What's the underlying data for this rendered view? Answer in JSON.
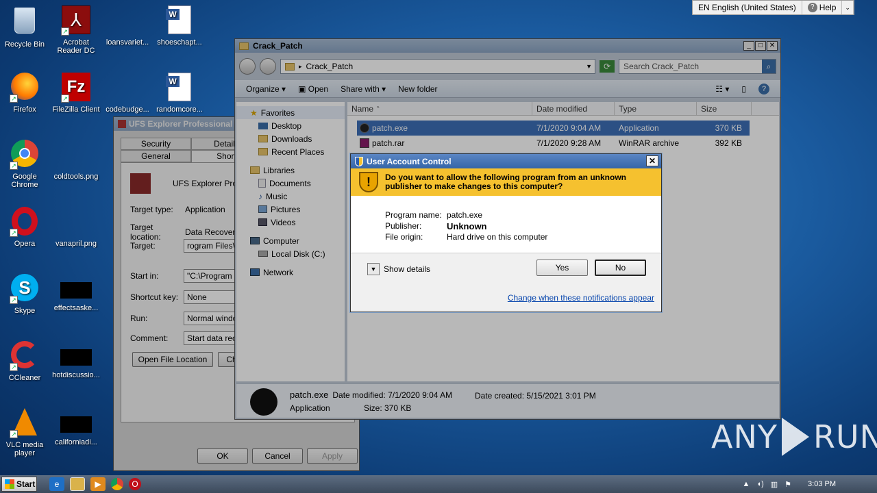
{
  "language_bar": {
    "language": "EN English (United States)",
    "help": "Help"
  },
  "desktop_icons": [
    {
      "label": "Recycle Bin"
    },
    {
      "label": "Acrobat Reader DC"
    },
    {
      "label": "loansvariet..."
    },
    {
      "label": "shoeschapt..."
    },
    {
      "label": "Firefox"
    },
    {
      "label": "FileZilla Client"
    },
    {
      "label": "codebudge..."
    },
    {
      "label": "randomcore..."
    },
    {
      "label": "Google Chrome"
    },
    {
      "label": "coldtools.png"
    },
    {
      "label": "Opera"
    },
    {
      "label": "vanapril.png"
    },
    {
      "label": "Skype"
    },
    {
      "label": "effectsaske..."
    },
    {
      "label": "CCleaner"
    },
    {
      "label": "hotdiscussio..."
    },
    {
      "label": "VLC media player"
    },
    {
      "label": "californiadi..."
    }
  ],
  "explorer": {
    "title": "Crack_Patch",
    "address": "Crack_Patch",
    "search_placeholder": "Search Crack_Patch",
    "toolbar": {
      "organize": "Organize",
      "open": "Open",
      "share_with": "Share with",
      "new_folder": "New folder"
    },
    "nav": {
      "favorites": "Favorites",
      "desktop": "Desktop",
      "downloads": "Downloads",
      "recent": "Recent Places",
      "libraries": "Libraries",
      "documents": "Documents",
      "music": "Music",
      "pictures": "Pictures",
      "videos": "Videos",
      "computer": "Computer",
      "local_disk": "Local Disk (C:)",
      "network": "Network"
    },
    "columns": {
      "name": "Name",
      "date": "Date modified",
      "type": "Type",
      "size": "Size"
    },
    "files": [
      {
        "name": "patch.exe",
        "date": "7/1/2020 9:04 AM",
        "type": "Application",
        "size": "370 KB"
      },
      {
        "name": "patch.rar",
        "date": "7/1/2020 9:28 AM",
        "type": "WinRAR archive",
        "size": "392 KB"
      }
    ],
    "details": {
      "name": "patch.exe",
      "date_modified": "Date modified: 7/1/2020 9:04 AM",
      "date_created": "Date created: 5/15/2021 3:01 PM",
      "type": "Application",
      "size": "Size: 370 KB"
    }
  },
  "ufs": {
    "title": "UFS Explorer Professional R",
    "tabs_top": {
      "security": "Security",
      "details": "Details"
    },
    "tabs_bottom": {
      "general": "General",
      "shortcut": "Short"
    },
    "app_name": "UFS Explorer Profe",
    "target_type_label": "Target type:",
    "target_type": "Application",
    "target_location_label": "Target location:",
    "target_location": "Data Recovery",
    "target_label": "Target:",
    "target": "rogram Files\\Da",
    "start_in_label": "Start in:",
    "start_in": "\"C:\\Program Fi",
    "shortcut_key_label": "Shortcut key:",
    "shortcut_key": "None",
    "run_label": "Run:",
    "run": "Normal window",
    "comment_label": "Comment:",
    "comment": "Start data reco",
    "open_location": "Open File Location",
    "change_icon": "Ch",
    "ok": "OK",
    "cancel": "Cancel",
    "apply": "Apply"
  },
  "uac": {
    "title": "User Account Control",
    "question": "Do you want to allow the following program from an unknown publisher to make changes to this computer?",
    "program_name_label": "Program name:",
    "program_name": "patch.exe",
    "publisher_label": "Publisher:",
    "publisher": "Unknown",
    "file_origin_label": "File origin:",
    "file_origin": "Hard drive on this computer",
    "show_details": "Show details",
    "yes": "Yes",
    "no": "No",
    "change_link": "Change when these notifications appear"
  },
  "taskbar": {
    "start": "Start",
    "time": "3:03 PM"
  },
  "watermark": {
    "left": "ANY",
    "right": "RUN"
  }
}
